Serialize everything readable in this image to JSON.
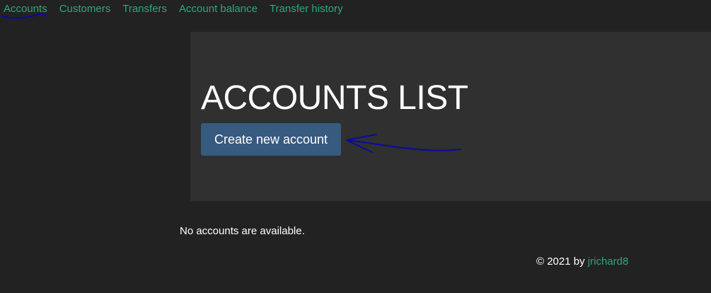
{
  "nav": {
    "items": [
      {
        "label": "Accounts",
        "active": true
      },
      {
        "label": "Customers",
        "active": false
      },
      {
        "label": "Transfers",
        "active": false
      },
      {
        "label": "Account balance",
        "active": false
      },
      {
        "label": "Transfer history",
        "active": false
      }
    ]
  },
  "main": {
    "title": "ACCOUNTS LIST",
    "create_button_label": "Create new account",
    "empty_message": "No accounts are available."
  },
  "footer": {
    "prefix": "© 2021 by ",
    "author": "jrichard8"
  },
  "colors": {
    "background": "#222222",
    "panel": "#303030",
    "link": "#2ba87c",
    "button": "#375a7f",
    "annotation_ink": "#0a0aa0"
  }
}
